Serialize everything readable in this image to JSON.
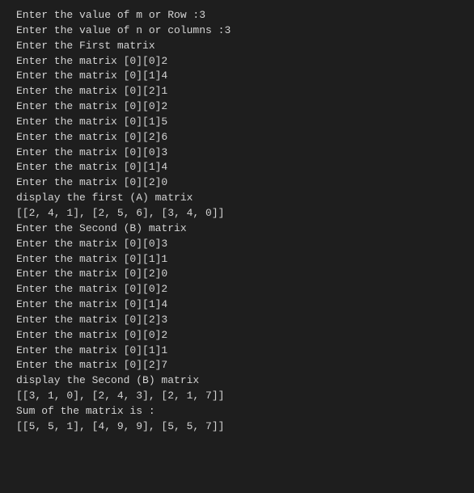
{
  "lines": [
    "Enter the value of m or Row :3",
    "Enter the value of n or columns :3",
    "Enter the First matrix",
    "Enter the matrix [0][0]2",
    "Enter the matrix [0][1]4",
    "Enter the matrix [0][2]1",
    "Enter the matrix [0][0]2",
    "Enter the matrix [0][1]5",
    "Enter the matrix [0][2]6",
    "Enter the matrix [0][0]3",
    "Enter the matrix [0][1]4",
    "Enter the matrix [0][2]0",
    "display the first (A) matrix",
    "[[2, 4, 1], [2, 5, 6], [3, 4, 0]]",
    "Enter the Second (B) matrix",
    "Enter the matrix [0][0]3",
    "Enter the matrix [0][1]1",
    "Enter the matrix [0][2]0",
    "Enter the matrix [0][0]2",
    "Enter the matrix [0][1]4",
    "Enter the matrix [0][2]3",
    "Enter the matrix [0][0]2",
    "Enter the matrix [0][1]1",
    "Enter the matrix [0][2]7",
    "display the Second (B) matrix",
    "[[3, 1, 0], [2, 4, 3], [2, 1, 7]]",
    "Sum of the matrix is :",
    "[[5, 5, 1], [4, 9, 9], [5, 5, 7]]"
  ]
}
